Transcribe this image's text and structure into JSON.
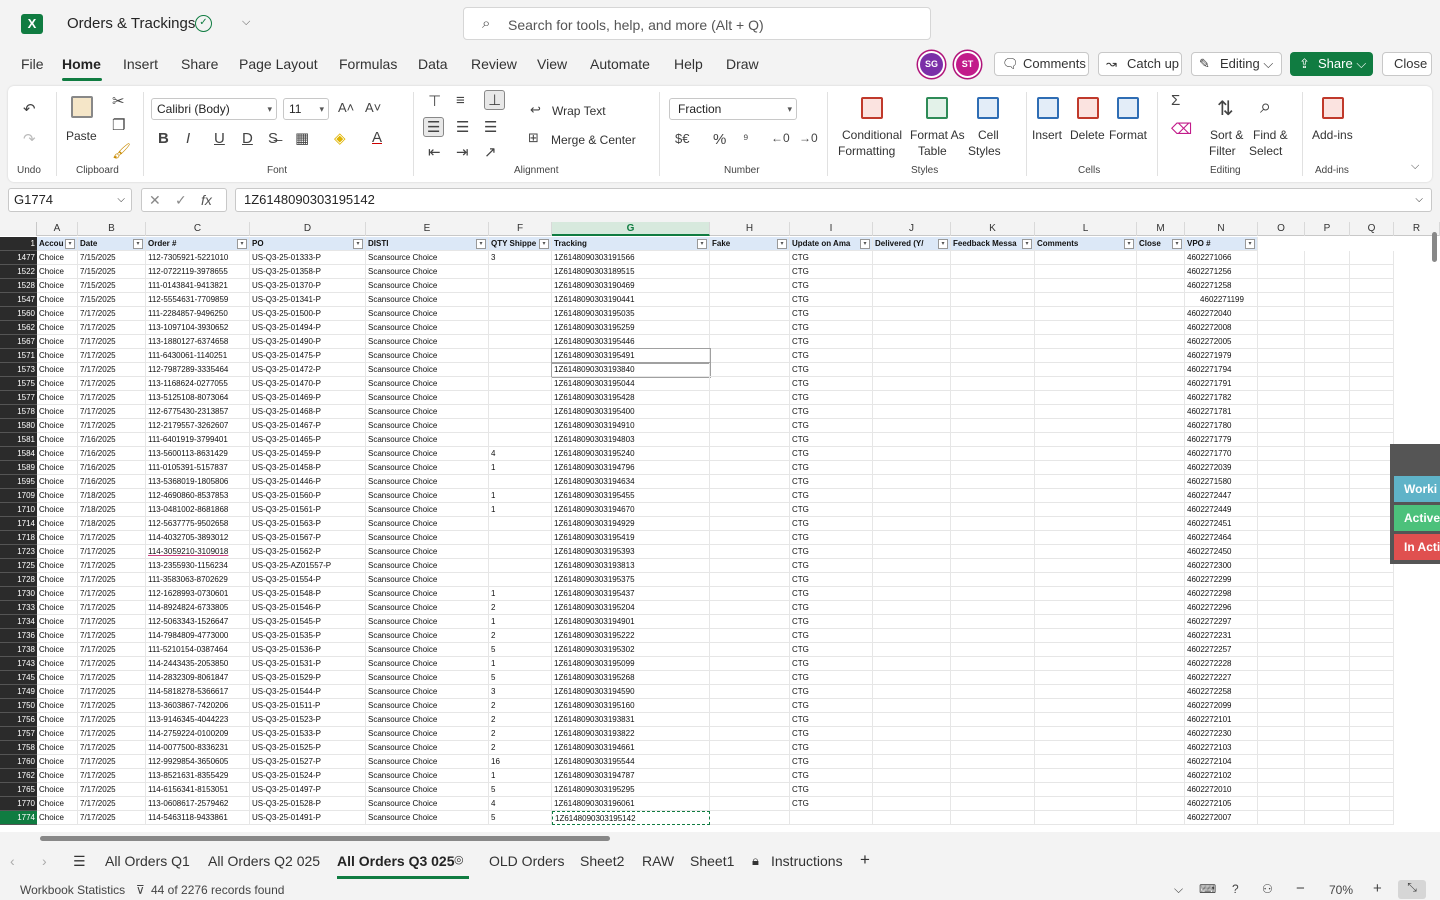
{
  "app": {
    "title": "Orders & Trackings",
    "search_placeholder": "Search for tools, help, and more (Alt + Q)"
  },
  "menu": [
    "File",
    "Home",
    "Insert",
    "Share",
    "Page Layout",
    "Formulas",
    "Data",
    "Review",
    "View",
    "Automate",
    "Help",
    "Draw"
  ],
  "avatars": [
    "SG",
    "ST"
  ],
  "toolbar": {
    "comments": "Comments",
    "catchup": "Catch up",
    "editing": "Editing",
    "share": "Share",
    "close": "Close"
  },
  "ribbon": {
    "undo_group": "Undo",
    "paste": "Paste",
    "clipboard_group": "Clipboard",
    "font_name": "Calibri (Body)",
    "font_size": "11",
    "font_group": "Font",
    "wrap_text": "Wrap Text",
    "merge_center": "Merge & Center",
    "alignment_group": "Alignment",
    "number_format": "Fraction",
    "number_group": "Number",
    "cond_fmt_1": "Conditional",
    "cond_fmt_2": "Formatting",
    "fmt_table_1": "Format As",
    "fmt_table_2": "Table",
    "cell_styles_1": "Cell",
    "cell_styles_2": "Styles",
    "styles_group": "Styles",
    "insert": "Insert",
    "delete": "Delete",
    "format": "Format",
    "cells_group": "Cells",
    "sort_1": "Sort &",
    "sort_2": "Filter",
    "find_1": "Find &",
    "find_2": "Select",
    "editing_group": "Editing",
    "addins": "Add-ins",
    "addins_group": "Add-ins"
  },
  "formula_bar": {
    "cell_ref": "G1774",
    "formula": "1Z6148090303195142"
  },
  "columns": [
    "A",
    "B",
    "C",
    "D",
    "E",
    "F",
    "G",
    "H",
    "I",
    "J",
    "K",
    "L",
    "M",
    "N",
    "O",
    "P",
    "Q",
    "R"
  ],
  "header_row": {
    "num": "1",
    "cells": [
      "Accou",
      "Date",
      "Order #",
      "PO",
      "DISTI",
      "QTY Shippe",
      "Tracking",
      "Fake",
      "Update on Ama",
      "Delivered (Y/",
      "Feedback Messa",
      "Comments",
      "Close",
      "VPO #"
    ]
  },
  "rows": [
    [
      "1477",
      "Choice",
      "7/15/2025",
      "112-7305921-5221010",
      "US-Q3-25-01333-P",
      "Scansource Choice",
      "3",
      "1Z6148090303191566",
      "CTG",
      "4602271066"
    ],
    [
      "1522",
      "Choice",
      "7/15/2025",
      "112-0722119-3978655",
      "US-Q3-25-01358-P",
      "Scansource Choice",
      "",
      "1Z6148090303189515",
      "CTG",
      "4602271256"
    ],
    [
      "1528",
      "Choice",
      "7/15/2025",
      "111-0143841-9413821",
      "US-Q3-25-01370-P",
      "Scansource Choice",
      "",
      "1Z6148090303190469",
      "CTG",
      "4602271258"
    ],
    [
      "1547",
      "Choice",
      "7/15/2025",
      "112-5554631-7709859",
      "US-Q3-25-01341-P",
      "Scansource Choice",
      "",
      "1Z6148090303190441",
      "CTG",
      "4602271199"
    ],
    [
      "1560",
      "Choice",
      "7/17/2025",
      "111-2284857-9496250",
      "US-Q3-25-01500-P",
      "Scansource Choice",
      "",
      "1Z6148090303195035",
      "CTG",
      "4602272040"
    ],
    [
      "1562",
      "Choice",
      "7/17/2025",
      "113-1097104-3930652",
      "US-Q3-25-01494-P",
      "Scansource Choice",
      "",
      "1Z6148090303195259",
      "CTG",
      "4602272008"
    ],
    [
      "1567",
      "Choice",
      "7/17/2025",
      "113-1880127-6374658",
      "US-Q3-25-01490-P",
      "Scansource Choice",
      "",
      "1Z6148090303195446",
      "CTG",
      "4602272005"
    ],
    [
      "1571",
      "Choice",
      "7/17/2025",
      "111-6430061-1140251",
      "US-Q3-25-01475-P",
      "Scansource Choice",
      "",
      "1Z6148090303195491",
      "CTG",
      "4602271979"
    ],
    [
      "1573",
      "Choice",
      "7/17/2025",
      "112-7987289-3335464",
      "US-Q3-25-01472-P",
      "Scansource Choice",
      "",
      "1Z6148090303193840",
      "CTG",
      "4602271794"
    ],
    [
      "1575",
      "Choice",
      "7/17/2025",
      "113-1168624-0277055",
      "US-Q3-25-01470-P",
      "Scansource Choice",
      "",
      "1Z6148090303195044",
      "CTG",
      "4602271791"
    ],
    [
      "1577",
      "Choice",
      "7/17/2025",
      "113-5125108-8073064",
      "US-Q3-25-01469-P",
      "Scansource Choice",
      "",
      "1Z6148090303195428",
      "CTG",
      "4602271782"
    ],
    [
      "1578",
      "Choice",
      "7/17/2025",
      "112-6775430-2313857",
      "US-Q3-25-01468-P",
      "Scansource Choice",
      "",
      "1Z6148090303195400",
      "CTG",
      "4602271781"
    ],
    [
      "1580",
      "Choice",
      "7/17/2025",
      "112-2179557-3262607",
      "US-Q3-25-01467-P",
      "Scansource Choice",
      "",
      "1Z6148090303194910",
      "CTG",
      "4602271780"
    ],
    [
      "1581",
      "Choice",
      "7/16/2025",
      "111-6401919-3799401",
      "US-Q3-25-01465-P",
      "Scansource Choice",
      "",
      "1Z6148090303194803",
      "CTG",
      "4602271779"
    ],
    [
      "1584",
      "Choice",
      "7/16/2025",
      "113-5600113-8631429",
      "US-Q3-25-01459-P",
      "Scansource Choice",
      "4",
      "1Z6148090303195240",
      "CTG",
      "4602271770"
    ],
    [
      "1589",
      "Choice",
      "7/16/2025",
      "111-0105391-5157837",
      "US-Q3-25-01458-P",
      "Scansource Choice",
      "1",
      "1Z6148090303194796",
      "CTG",
      "4602272039"
    ],
    [
      "1595",
      "Choice",
      "7/16/2025",
      "113-5368019-1805806",
      "US-Q3-25-01446-P",
      "Scansource Choice",
      "",
      "1Z6148090303194634",
      "CTG",
      "4602271580"
    ],
    [
      "1709",
      "Choice",
      "7/18/2025",
      "112-4690860-8537853",
      "US-Q3-25-01560-P",
      "Scansource Choice",
      "1",
      "1Z6148090303195455",
      "CTG",
      "4602272447"
    ],
    [
      "1710",
      "Choice",
      "7/18/2025",
      "113-0481002-8681868",
      "US-Q3-25-01561-P",
      "Scansource Choice",
      "1",
      "1Z6148090303194670",
      "CTG",
      "4602272449"
    ],
    [
      "1714",
      "Choice",
      "7/18/2025",
      "112-5637775-9502658",
      "US-Q3-25-01563-P",
      "Scansource Choice",
      "",
      "1Z6148090303194929",
      "CTG",
      "4602272451"
    ],
    [
      "1718",
      "Choice",
      "7/17/2025",
      "114-4032705-3893012",
      "US-Q3-25-01567-P",
      "Scansource Choice",
      "",
      "1Z6148090303195419",
      "CTG",
      "4602272464"
    ],
    [
      "1723",
      "Choice",
      "7/17/2025",
      "114-3059210-3109018",
      "US-Q3-25-01562-P",
      "Scansource Choice",
      "",
      "1Z6148090303195393",
      "CTG",
      "4602272450"
    ],
    [
      "1725",
      "Choice",
      "7/17/2025",
      "113-2355930-1156234",
      "US-Q3-25-AZ01557-P",
      "Scansource Choice",
      "",
      "1Z6148090303193813",
      "CTG",
      "4602272300"
    ],
    [
      "1728",
      "Choice",
      "7/17/2025",
      "111-3583063-8702629",
      "US-Q3-25-01554-P",
      "Scansource Choice",
      "",
      "1Z6148090303195375",
      "CTG",
      "4602272299"
    ],
    [
      "1730",
      "Choice",
      "7/17/2025",
      "112-1628993-0730601",
      "US-Q3-25-01548-P",
      "Scansource Choice",
      "1",
      "1Z6148090303195437",
      "CTG",
      "4602272298"
    ],
    [
      "1733",
      "Choice",
      "7/17/2025",
      "114-8924824-6733805",
      "US-Q3-25-01546-P",
      "Scansource Choice",
      "2",
      "1Z6148090303195204",
      "CTG",
      "4602272296"
    ],
    [
      "1734",
      "Choice",
      "7/17/2025",
      "112-5063343-1526647",
      "US-Q3-25-01545-P",
      "Scansource Choice",
      "1",
      "1Z6148090303194901",
      "CTG",
      "4602272297"
    ],
    [
      "1736",
      "Choice",
      "7/17/2025",
      "114-7984809-4773000",
      "US-Q3-25-01535-P",
      "Scansource Choice",
      "2",
      "1Z6148090303195222",
      "CTG",
      "4602272231"
    ],
    [
      "1738",
      "Choice",
      "7/17/2025",
      "111-5210154-0387464",
      "US-Q3-25-01536-P",
      "Scansource Choice",
      "5",
      "1Z6148090303195302",
      "CTG",
      "4602272257"
    ],
    [
      "1743",
      "Choice",
      "7/17/2025",
      "114-2443435-2053850",
      "US-Q3-25-01531-P",
      "Scansource Choice",
      "1",
      "1Z6148090303195099",
      "CTG",
      "4602272228"
    ],
    [
      "1745",
      "Choice",
      "7/17/2025",
      "114-2832309-8061847",
      "US-Q3-25-01529-P",
      "Scansource Choice",
      "5",
      "1Z6148090303195268",
      "CTG",
      "4602272227"
    ],
    [
      "1749",
      "Choice",
      "7/17/2025",
      "114-5818278-5366617",
      "US-Q3-25-01544-P",
      "Scansource Choice",
      "3",
      "1Z6148090303194590",
      "CTG",
      "4602272258"
    ],
    [
      "1750",
      "Choice",
      "7/17/2025",
      "113-3603867-7420206",
      "US-Q3-25-01511-P",
      "Scansource Choice",
      "2",
      "1Z6148090303195160",
      "CTG",
      "4602272099"
    ],
    [
      "1756",
      "Choice",
      "7/17/2025",
      "113-9146345-4044223",
      "US-Q3-25-01523-P",
      "Scansource Choice",
      "2",
      "1Z6148090303193831",
      "CTG",
      "4602272101"
    ],
    [
      "1757",
      "Choice",
      "7/17/2025",
      "114-2759224-0100209",
      "US-Q3-25-01533-P",
      "Scansource Choice",
      "2",
      "1Z6148090303193822",
      "CTG",
      "4602272230"
    ],
    [
      "1758",
      "Choice",
      "7/17/2025",
      "114-0077500-8336231",
      "US-Q3-25-01525-P",
      "Scansource Choice",
      "2",
      "1Z6148090303194661",
      "CTG",
      "4602272103"
    ],
    [
      "1760",
      "Choice",
      "7/17/2025",
      "112-9929854-3650605",
      "US-Q3-25-01527-P",
      "Scansource Choice",
      "16",
      "1Z6148090303195544",
      "CTG",
      "4602272104"
    ],
    [
      "1762",
      "Choice",
      "7/17/2025",
      "113-8521631-8355429",
      "US-Q3-25-01524-P",
      "Scansource Choice",
      "1",
      "1Z6148090303194787",
      "CTG",
      "4602272102"
    ],
    [
      "1765",
      "Choice",
      "7/17/2025",
      "114-6156341-8153051",
      "US-Q3-25-01497-P",
      "Scansource Choice",
      "5",
      "1Z6148090303195295",
      "CTG",
      "4602272010"
    ],
    [
      "1770",
      "Choice",
      "7/17/2025",
      "113-0608617-2579462",
      "US-Q3-25-01528-P",
      "Scansource Choice",
      "4",
      "1Z6148090303196061",
      "CTG",
      "4602272105"
    ],
    [
      "1774",
      "Choice",
      "7/17/2025",
      "114-5463118-9433861",
      "US-Q3-25-01491-P",
      "Scansource Choice",
      "5",
      "1Z6148090303195142",
      "",
      "4602272007"
    ]
  ],
  "side_panel": [
    "Worki",
    "Active",
    "In Acti"
  ],
  "side_colors": [
    "#5fb3c8",
    "#4cc17b",
    "#e0504f"
  ],
  "sheet_tabs": [
    "All Orders Q1",
    "All Orders Q2 025",
    "All Orders Q3 025",
    "OLD Orders",
    "Sheet2",
    "RAW",
    "Sheet1",
    "Instructions"
  ],
  "status": {
    "stats": "Workbook Statistics",
    "records": "44 of 2276 records found",
    "zoom": "70%"
  }
}
